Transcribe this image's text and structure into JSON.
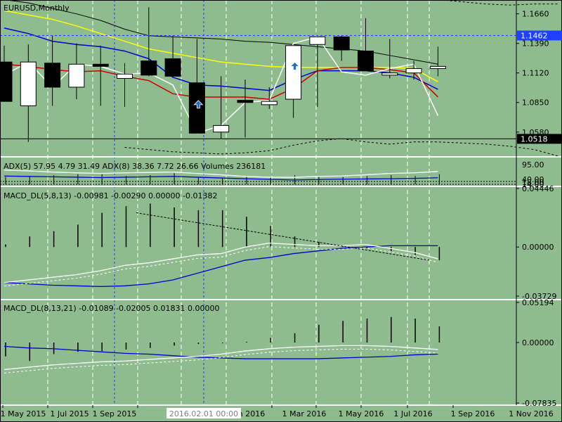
{
  "window": {
    "symbol_label": "EURUSD,Monthly",
    "crosshair_date": "2016.02.01 00:00"
  },
  "colors": {
    "background": "#8fbc8f",
    "bull_candle": "#ffffff",
    "bear_candle": "#000000",
    "ma_slow": "#000000",
    "ma_yellow": "#ffff00",
    "ma_blue": "#0000cd",
    "ma_red": "#cc0000",
    "close_line": "#ffffff",
    "arrow": "#1e6fd0",
    "price_tag": "#1e40ff"
  },
  "chart_data": [
    {
      "type": "candlestick",
      "panel": "main",
      "title": "EURUSD,Monthly",
      "x": [
        "2015-03",
        "2015-04",
        "2015-05",
        "2015-06",
        "2015-07",
        "2015-08",
        "2015-09",
        "2015-10",
        "2015-11",
        "2015-12",
        "2016-01",
        "2016-02",
        "2016-03",
        "2016-04",
        "2016-05",
        "2016-06",
        "2016-07",
        "2016-08",
        "2016-09"
      ],
      "open": [
        1.122,
        1.082,
        1.121,
        1.099,
        1.12,
        1.107,
        1.123,
        1.125,
        1.103,
        1.058,
        1.087,
        1.083,
        1.088,
        1.138,
        1.145,
        1.132,
        1.11,
        1.112,
        1.116
      ],
      "high": [
        1.137,
        1.138,
        1.146,
        1.139,
        1.137,
        1.121,
        1.172,
        1.146,
        1.143,
        1.109,
        1.106,
        1.099,
        1.112,
        1.139,
        1.146,
        1.162,
        1.143,
        1.123,
        1.136
      ],
      "low": [
        1.086,
        1.049,
        1.082,
        1.088,
        1.082,
        1.081,
        1.109,
        1.109,
        1.071,
        1.052,
        1.053,
        1.079,
        1.071,
        1.081,
        1.123,
        1.122,
        1.107,
        1.106,
        1.109
      ],
      "close": [
        1.086,
        1.122,
        1.099,
        1.12,
        1.118,
        1.111,
        1.11,
        1.109,
        1.057,
        1.064,
        1.085,
        1.086,
        1.137,
        1.145,
        1.133,
        1.114,
        1.112,
        1.116,
        1.118
      ],
      "yticks": [
        "1.1660",
        "1.1390",
        "1.1120",
        "1.0850",
        "1.0580"
      ],
      "ylim": [
        1.036,
        1.178
      ],
      "price_line": "1.1462",
      "last_price": "1.0518",
      "series": [
        {
          "name": "",
          "key": "ma_slow",
          "values": [
            1.179,
            1.176,
            1.171,
            1.166,
            1.16,
            1.152,
            1.146,
            1.145,
            1.144,
            1.143,
            1.141,
            1.14,
            1.138,
            1.136,
            1.134,
            1.132,
            1.128,
            1.124,
            1.12
          ]
        },
        {
          "name": "",
          "key": "ma_yellow",
          "values": [
            1.169,
            1.165,
            1.161,
            1.155,
            1.148,
            1.141,
            1.134,
            1.13,
            1.126,
            1.122,
            1.12,
            1.118,
            1.117,
            1.117,
            1.117,
            1.117,
            1.117,
            1.116,
            1.104
          ]
        },
        {
          "name": "",
          "key": "ma_blue",
          "values": [
            1.153,
            1.148,
            1.141,
            1.138,
            1.136,
            1.132,
            1.125,
            1.108,
            1.101,
            1.1,
            1.098,
            1.096,
            1.106,
            1.114,
            1.114,
            1.114,
            1.112,
            1.108,
            1.097
          ]
        },
        {
          "name": "",
          "key": "ma_red",
          "values": [
            1.12,
            1.118,
            1.115,
            1.113,
            1.114,
            1.109,
            1.105,
            1.093,
            1.09,
            1.09,
            1.09,
            1.088,
            1.098,
            1.114,
            1.117,
            1.117,
            1.115,
            1.112,
            1.09
          ]
        },
        {
          "name": "",
          "key": "close_line",
          "values": [
            1.11,
            1.122,
            1.099,
            1.12,
            1.118,
            1.111,
            1.112,
            1.101,
            1.057,
            1.064,
            1.085,
            1.087,
            1.139,
            1.145,
            1.113,
            1.11,
            1.116,
            1.12,
            1.073
          ]
        }
      ]
    },
    {
      "type": "line",
      "panel": "adx",
      "title": "ADX(5) 57.95 4.79 31.49 ADX(8) 38.36 7.72 26.66 Volumes 236181",
      "yticks": [
        "95.00",
        "40.00",
        "18.00",
        "14.00"
      ]
    },
    {
      "type": "bar",
      "panel": "macd1",
      "title": "MACD_DL(5,8,13) -0.00981 -0.00290 0.00000 -0.01382",
      "yticks": [
        "0.04446",
        "0.00000",
        "-0.03729"
      ],
      "ylim": [
        -0.03729,
        0.04446
      ],
      "hist": [
        0.002,
        0.008,
        0.012,
        0.017,
        0.026,
        0.031,
        0.033,
        0.03,
        0.028,
        0.028,
        0.023,
        0.016,
        0.008,
        0.004,
        0.001,
        -0.001,
        -0.003,
        -0.006,
        -0.01
      ],
      "series": [
        {
          "name": "",
          "key": "ma_blue",
          "values": [
            -0.027,
            -0.028,
            -0.029,
            -0.0295,
            -0.03,
            -0.0295,
            -0.028,
            -0.025,
            -0.02,
            -0.015,
            -0.01,
            -0.008,
            -0.005,
            -0.003,
            -0.001,
            0.0,
            0.001,
            0.001,
            0.001
          ]
        },
        {
          "name": "",
          "key": "close_line",
          "values": [
            -0.027,
            -0.025,
            -0.023,
            -0.021,
            -0.018,
            -0.014,
            -0.012,
            -0.009,
            -0.006,
            -0.005,
            0.0,
            0.003,
            0.002,
            0.001,
            0.001,
            0.002,
            -0.001,
            -0.004,
            -0.009
          ]
        }
      ]
    },
    {
      "type": "bar",
      "panel": "macd2",
      "title": "MACD_DL(8,13,21) -0.01089 -0.02005 0.01831 0.00000",
      "yticks": [
        "0.05194",
        "0.00000",
        "-0.07835"
      ],
      "ylim": [
        -0.07835,
        0.05194
      ],
      "hist": [
        -0.018,
        -0.024,
        -0.015,
        -0.012,
        -0.011,
        -0.009,
        -0.007,
        -0.004,
        -0.002,
        -0.001,
        0.001,
        0.006,
        0.012,
        0.023,
        0.028,
        0.031,
        0.033,
        0.031,
        0.021
      ],
      "series": [
        {
          "name": "",
          "key": "ma_blue",
          "values": [
            -0.005,
            -0.007,
            -0.008,
            -0.01,
            -0.012,
            -0.014,
            -0.015,
            -0.017,
            -0.019,
            -0.02,
            -0.021,
            -0.021,
            -0.021,
            -0.021,
            -0.02,
            -0.019,
            -0.018,
            -0.016,
            -0.015
          ]
        },
        {
          "name": "",
          "key": "close_line",
          "values": [
            -0.035,
            -0.032,
            -0.029,
            -0.027,
            -0.025,
            -0.024,
            -0.022,
            -0.02,
            -0.018,
            -0.015,
            -0.011,
            -0.008,
            -0.006,
            -0.005,
            -0.004,
            -0.004,
            -0.005,
            -0.007,
            -0.009
          ]
        }
      ]
    }
  ],
  "time_axis": [
    "1 May 2015",
    "1 Jul 2015",
    "1 Sep 2015",
    "n 2016",
    "1 Mar 2016",
    "1 May 2016",
    "1 Jul 2016",
    "1 Sep 2016",
    "1 Nov 2016"
  ]
}
